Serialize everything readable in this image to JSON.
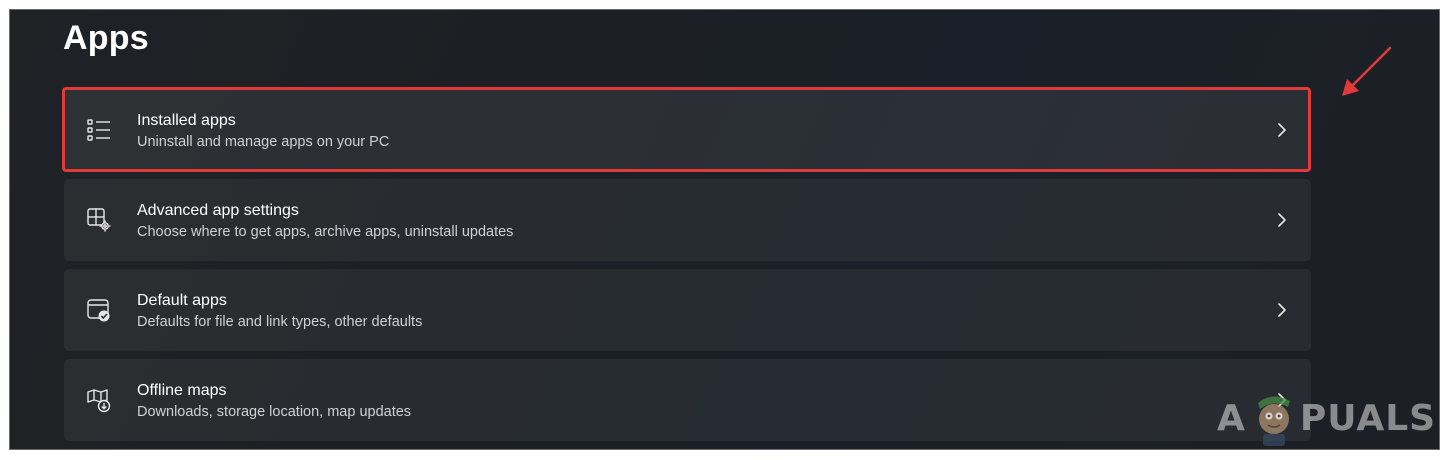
{
  "page": {
    "title": "Apps"
  },
  "items": [
    {
      "title": "Installed apps",
      "subtitle": "Uninstall and manage apps on your PC",
      "icon": "list-icon",
      "highlighted": true
    },
    {
      "title": "Advanced app settings",
      "subtitle": "Choose where to get apps, archive apps, uninstall updates",
      "icon": "app-settings-icon",
      "highlighted": false
    },
    {
      "title": "Default apps",
      "subtitle": "Defaults for file and link types, other defaults",
      "icon": "default-apps-icon",
      "highlighted": false
    },
    {
      "title": "Offline maps",
      "subtitle": "Downloads, storage location, map updates",
      "icon": "offline-map-icon",
      "highlighted": false
    }
  ],
  "annotation": {
    "highlight_color": "#e03a3a",
    "arrow_color": "#e03a3a"
  },
  "watermark": {
    "text_left": "A",
    "text_right": "PUALS"
  },
  "colors": {
    "background": "#1d2126",
    "card": "#2b2f33",
    "text_primary": "#ffffff",
    "text_secondary": "#cfd1d4"
  }
}
